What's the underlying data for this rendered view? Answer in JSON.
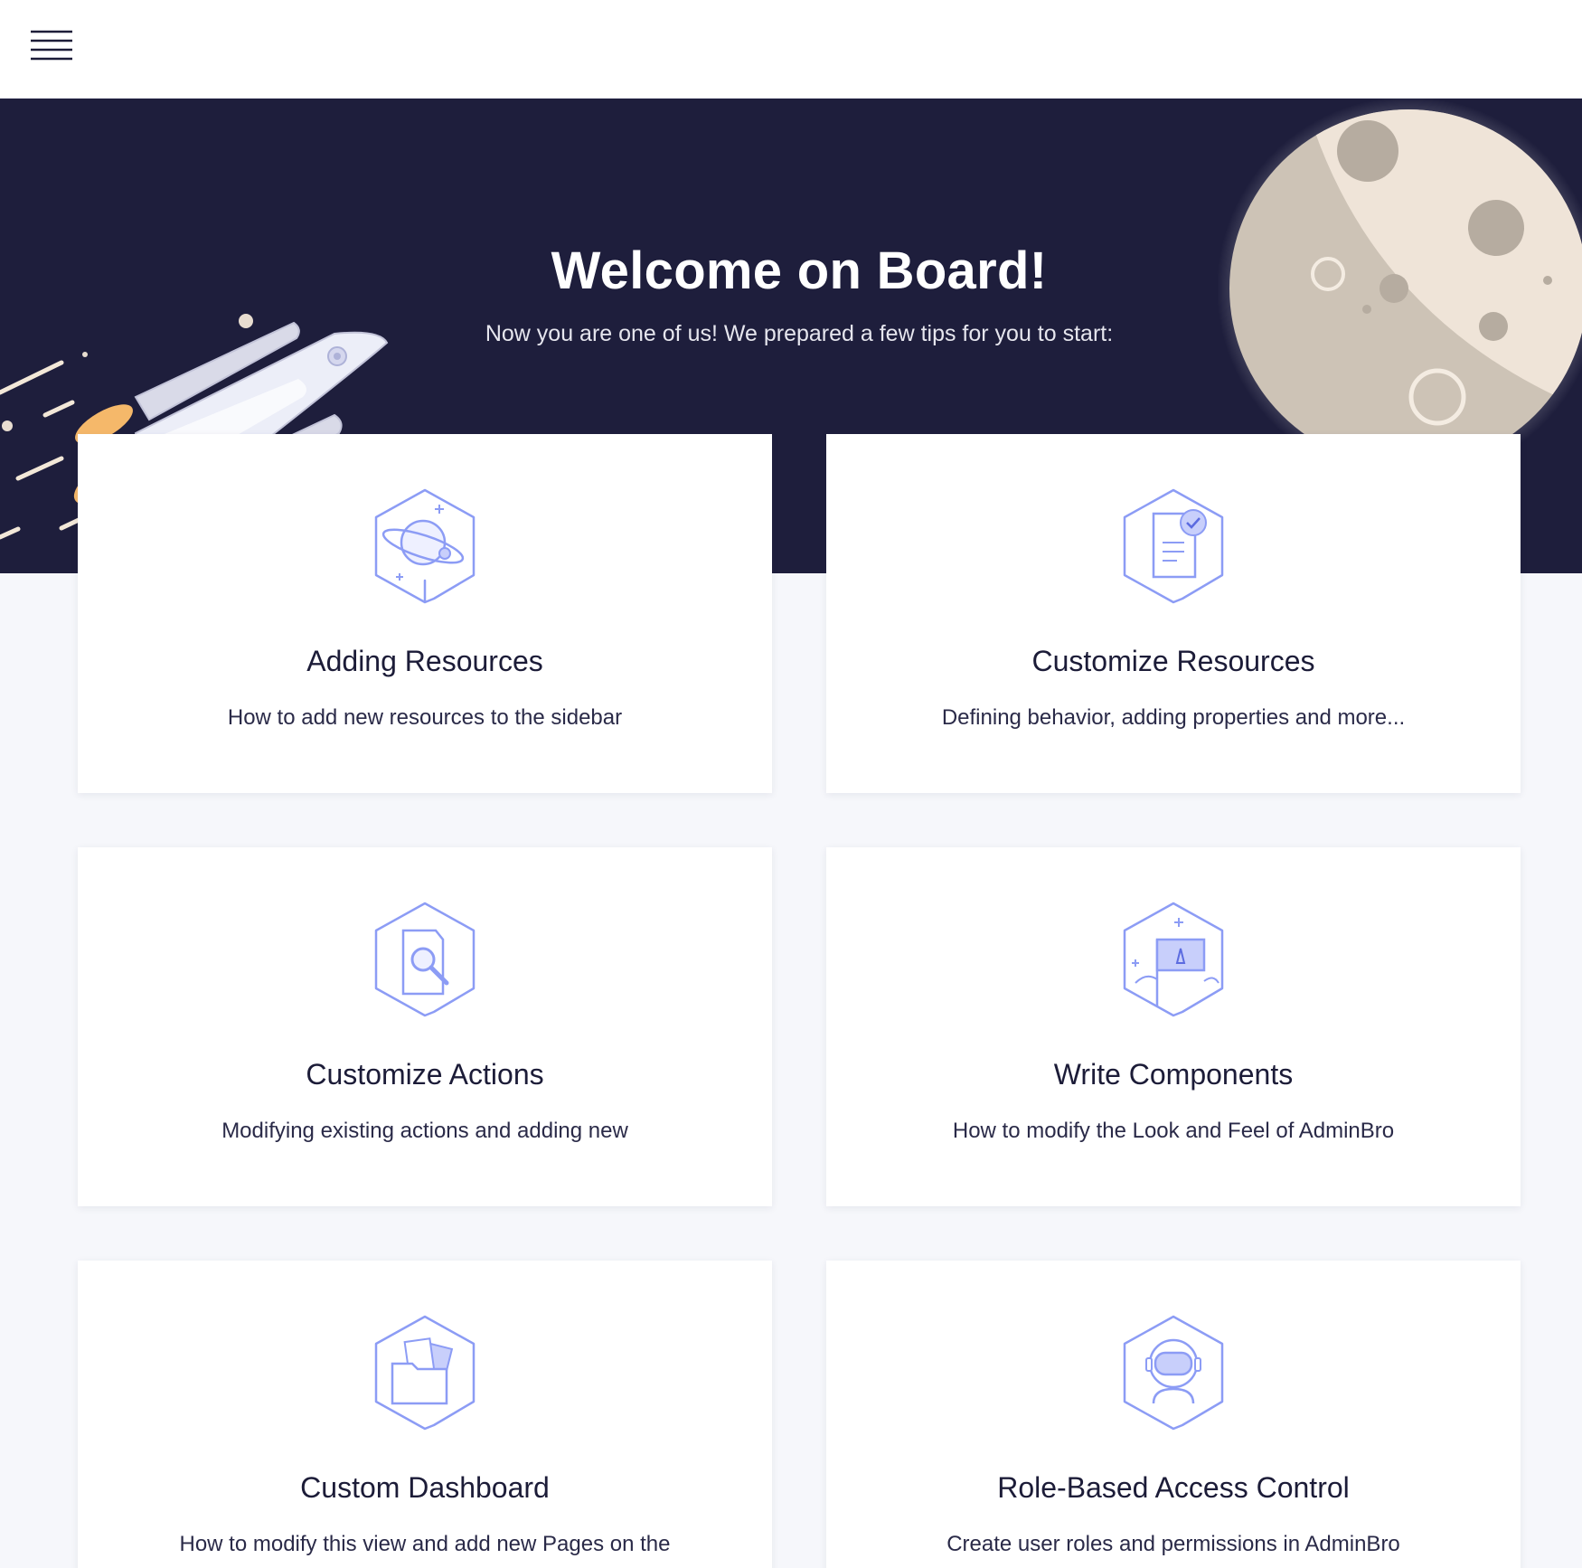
{
  "header": {
    "menu_icon": "hamburger-menu-icon"
  },
  "hero": {
    "title": "Welcome on Board!",
    "subtitle": "Now you are one of us! We prepared a few tips for you to start:",
    "background_color": "#1e1e3c",
    "illustrations": [
      "rocket-illustration",
      "moon-illustration"
    ]
  },
  "accent_color": "#8c9cf5",
  "cards": [
    {
      "title": "Adding Resources",
      "description": "How to add new resources to the sidebar",
      "icon": "planet-icon"
    },
    {
      "title": "Customize Resources",
      "description": "Defining behavior, adding properties and more...",
      "icon": "document-check-icon"
    },
    {
      "title": "Customize Actions",
      "description": "Modifying existing actions and adding new",
      "icon": "document-search-icon"
    },
    {
      "title": "Write Components",
      "description": "How to modify the Look and Feel of AdminBro",
      "icon": "flag-icon"
    },
    {
      "title": "Custom Dashboard",
      "description": "How to modify this view and add new Pages on the",
      "icon": "folder-icon"
    },
    {
      "title": "Role-Based Access Control",
      "description": "Create user roles and permissions in AdminBro",
      "icon": "astronaut-icon"
    }
  ]
}
